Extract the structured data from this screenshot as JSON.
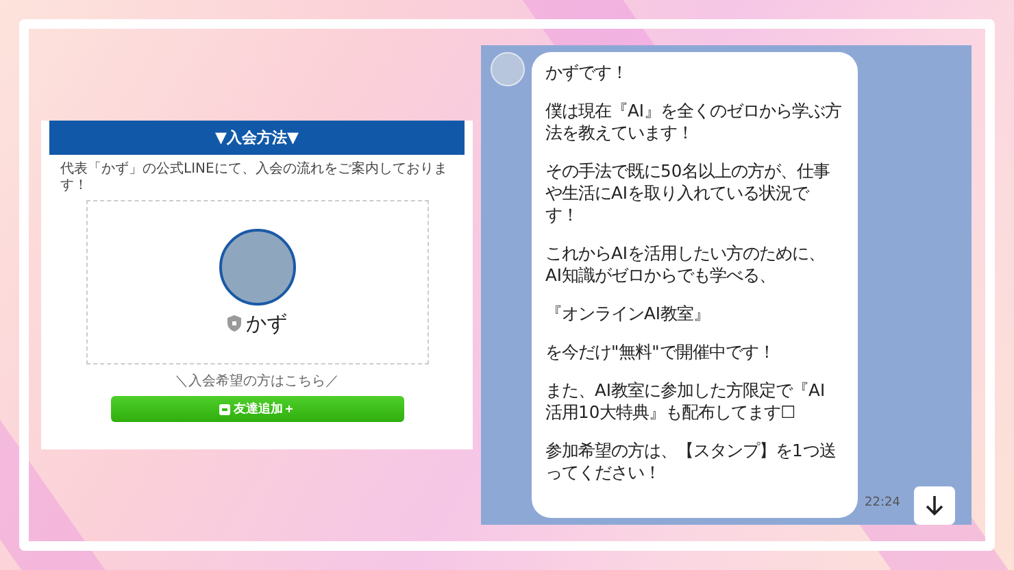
{
  "signup_page": {
    "header": "▼入会方法▼",
    "intro": "代表「かず」の公式LINEにて、入会の流れをご案内しております！",
    "profile": {
      "name": "かず"
    },
    "caption": "＼入会希望の方はこちら／",
    "add_friend_button": "友達追加＋"
  },
  "chat": {
    "message": {
      "paragraphs": [
        [
          "かずです！"
        ],
        [
          "僕は現在『AI』を全くのゼロから学ぶ方",
          "法を教えています！"
        ],
        [
          "その手法で既に50名以上の方が、仕事",
          "や生活にAIを取り入れている状況で",
          "す！"
        ],
        [
          "これからAIを活用したい方のために、",
          "AI知識がゼロからでも学べる、"
        ],
        [
          "『オンラインAI教室』"
        ],
        [
          "を今だけ\"無料\"で開催中です！"
        ],
        [
          "また、AI教室に参加した方限定で『AI",
          "活用10大特典』も配布してます☐"
        ],
        [
          "参加希望の方は、【スタンプ】を1つ送",
          "ってください！"
        ]
      ],
      "time": "22:24"
    }
  }
}
